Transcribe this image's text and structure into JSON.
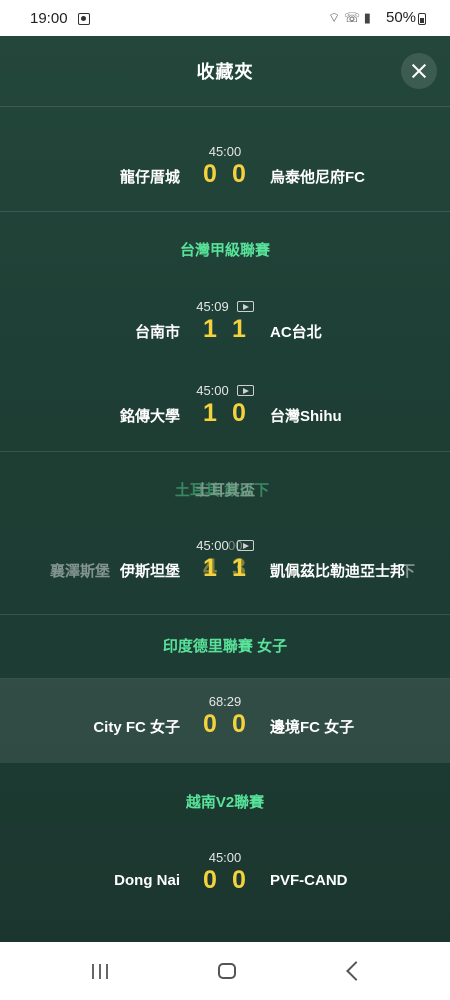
{
  "status_bar": {
    "time": "19:00",
    "battery": "50%",
    "system_icons": "wifi-call, vo-wifi, signal"
  },
  "header": {
    "title": "收藏夾"
  },
  "sections": [
    {
      "league": "",
      "matches": [
        {
          "time": "45:00",
          "home": "龍仔厝城",
          "score_home": "0",
          "score_away": "0",
          "away": "烏泰他尼府FC",
          "has_video": false
        }
      ]
    },
    {
      "league": "台灣甲級聯賽",
      "matches": [
        {
          "time": "45:09",
          "home": "台南市",
          "score_home": "1",
          "score_away": "1",
          "away": "AC台北",
          "has_video": true
        },
        {
          "time": "45:00",
          "home": "銘傳大學",
          "score_home": "1",
          "score_away": "0",
          "away": "台灣Shihu",
          "has_video": true
        }
      ]
    },
    {
      "league": "土耳其盃",
      "league_ghost": "土耳其 歲以下",
      "matches": [
        {
          "time": "45:00",
          "home": "伊斯坦堡",
          "score_home": "1",
          "score_away": "1",
          "away": "凱佩茲比勒迪亞士邦",
          "has_video": true,
          "ghost": {
            "time": "00",
            "home": "襄澤斯堡",
            "score_home": "4",
            "score_away": "3",
            "away": "下"
          }
        }
      ]
    },
    {
      "league": "印度德里聯賽 女子",
      "matches": [
        {
          "time": "68:29",
          "home": "City FC 女子",
          "score_home": "0",
          "score_away": "0",
          "away": "邊境FC 女子",
          "has_video": false,
          "highlighted": true
        }
      ]
    },
    {
      "league": "越南V2聯賽",
      "matches": [
        {
          "time": "45:00",
          "home": "Dong Nai",
          "score_home": "0",
          "score_away": "0",
          "away": "PVF-CAND",
          "has_video": false
        }
      ]
    }
  ],
  "colors": {
    "background_top": "#24473b",
    "background_bottom": "#1b362e",
    "league_text": "#58e29a",
    "score": "#f4d23d"
  },
  "nav_bar": {
    "icons": [
      "recents-icon",
      "home-icon",
      "back-icon"
    ]
  }
}
